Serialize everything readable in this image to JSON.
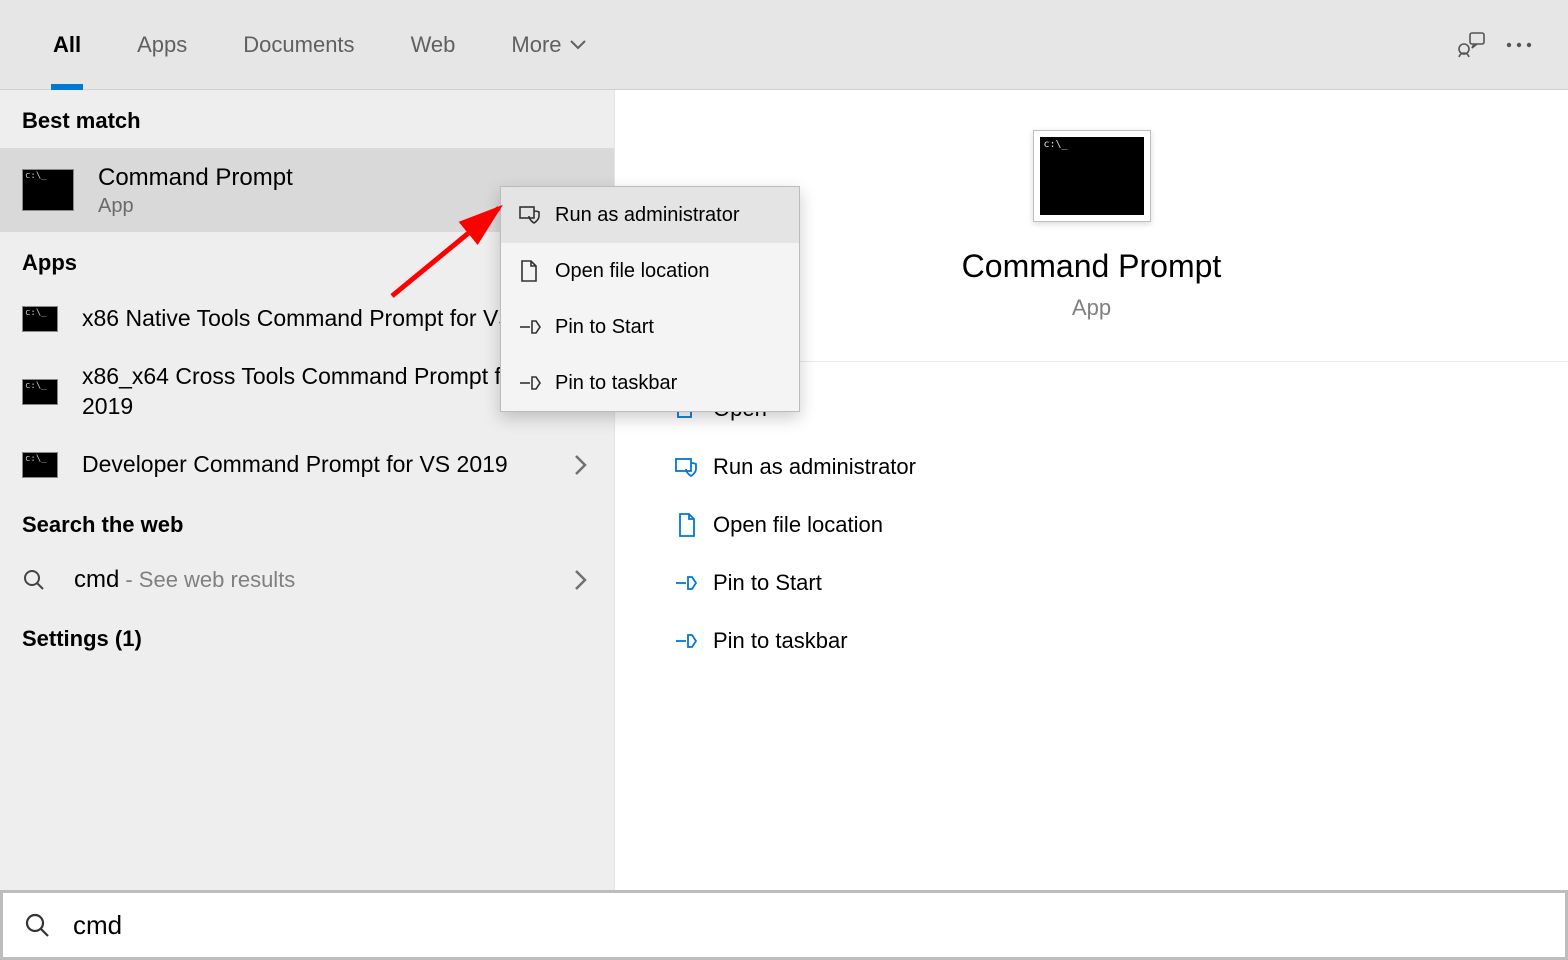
{
  "tabs": {
    "all": "All",
    "apps": "Apps",
    "documents": "Documents",
    "web": "Web",
    "more": "More"
  },
  "left": {
    "best_match": "Best match",
    "best": {
      "title": "Command Prompt",
      "sub": "App"
    },
    "apps_header": "Apps",
    "apps": [
      "x86 Native Tools Command Prompt for VS 2019",
      "x86_x64 Cross Tools Command Prompt for VS 2019",
      "Developer Command Prompt for VS 2019"
    ],
    "web_header": "Search the web",
    "web_query": "cmd",
    "web_hint": "- See web results",
    "settings_header": "Settings (1)"
  },
  "context_menu": {
    "run_admin": "Run as administrator",
    "open_loc": "Open file location",
    "pin_start": "Pin to Start",
    "pin_taskbar": "Pin to taskbar"
  },
  "detail": {
    "title": "Command Prompt",
    "sub": "App",
    "actions": {
      "open": "Open",
      "run_admin": "Run as administrator",
      "open_loc": "Open file location",
      "pin_start": "Pin to Start",
      "pin_taskbar": "Pin to taskbar"
    }
  },
  "searchbar": {
    "value": "cmd"
  }
}
